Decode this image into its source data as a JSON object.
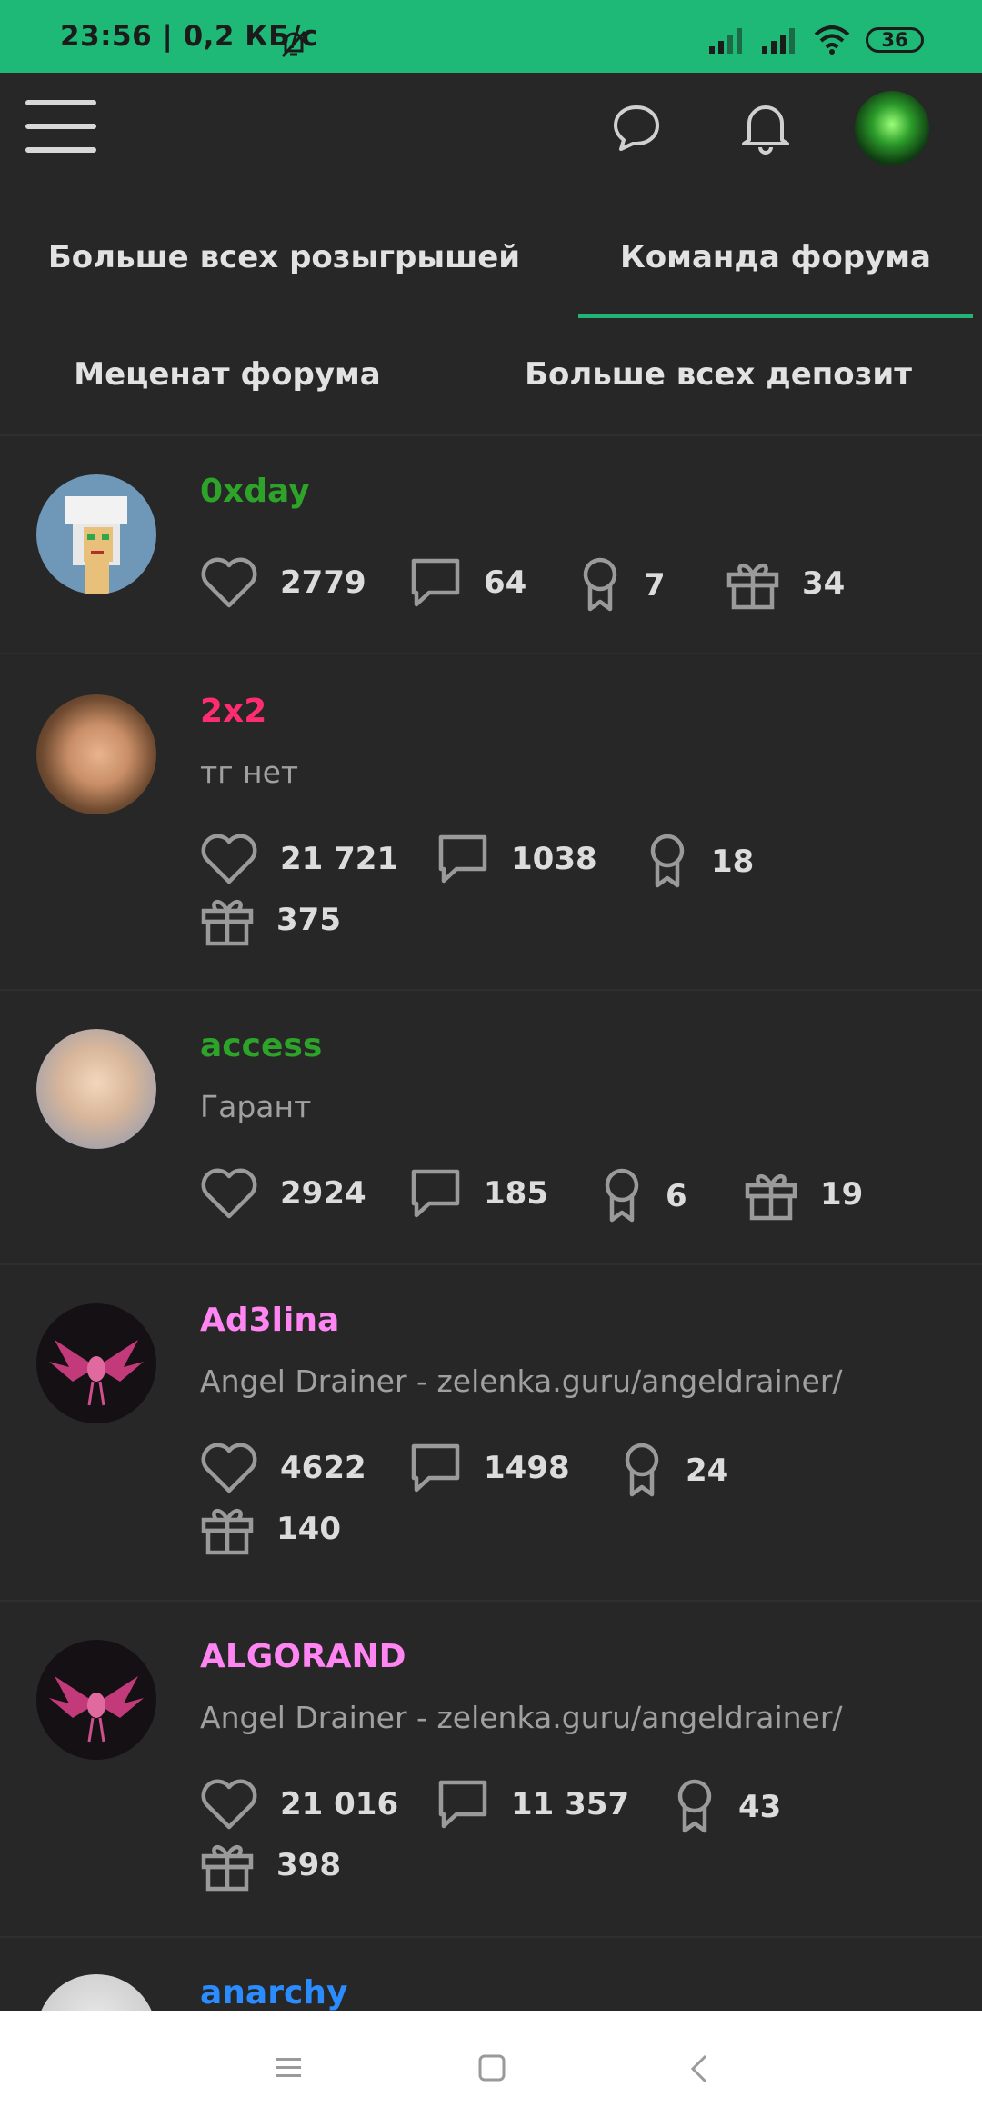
{
  "status_bar": {
    "time": "23:56 | 0,2 КБ/с",
    "battery": "36"
  },
  "tabs": [
    {
      "label": "Больше всех розыгрышей"
    },
    {
      "label": "Команда форума"
    },
    {
      "label": "Меценат форума"
    },
    {
      "label": "Больше всех депозит"
    }
  ],
  "users": [
    {
      "name": "0xday",
      "color": "#2ea32a",
      "subtitle": "",
      "likes": "2779",
      "messages": "64",
      "awards": "7",
      "gifts": "34"
    },
    {
      "name": "2x2",
      "color": "#ff2d6f",
      "subtitle": "тг нет",
      "likes": "21 721",
      "messages": "1038",
      "awards": "18",
      "gifts": "375"
    },
    {
      "name": "access",
      "color": "#2ea32a",
      "subtitle": "Гарант",
      "likes": "2924",
      "messages": "185",
      "awards": "6",
      "gifts": "19"
    },
    {
      "name": "Ad3lina",
      "color": "#ff86f2",
      "subtitle": "Angel Drainer - zelenka.guru/angeldrainer/",
      "likes": "4622",
      "messages": "1498",
      "awards": "24",
      "gifts": "140"
    },
    {
      "name": "ALGORAND",
      "color": "#ff86f2",
      "subtitle": "Angel Drainer - zelenka.guru/angeldrainer/",
      "likes": "21 016",
      "messages": "11 357",
      "awards": "43",
      "gifts": "398"
    },
    {
      "name": "anarchy",
      "color": "#2a8cff",
      "subtitle": "",
      "likes": "",
      "messages": "",
      "awards": "",
      "gifts": ""
    }
  ]
}
